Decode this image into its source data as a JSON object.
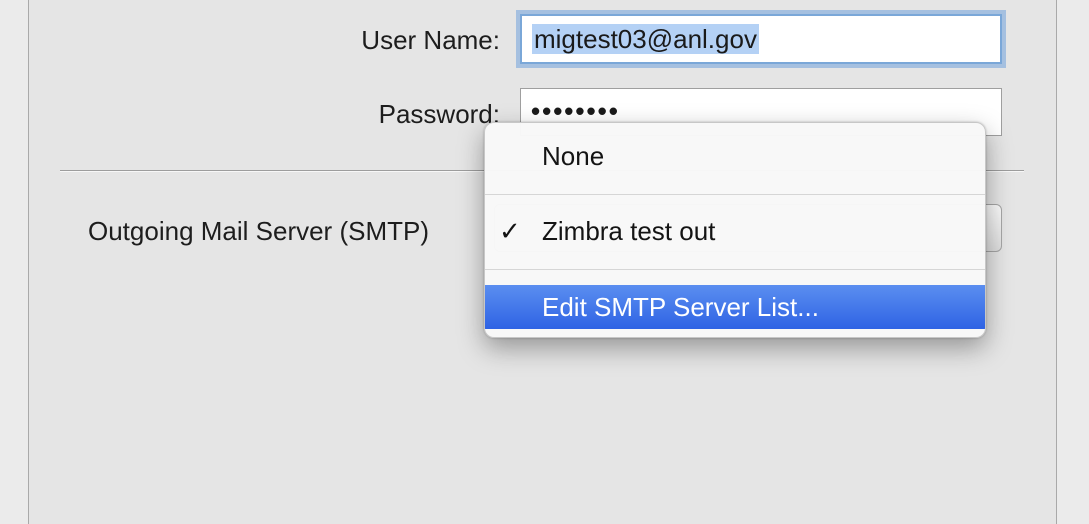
{
  "account_form": {
    "user_name_label": "User Name:",
    "user_name_value": "migtest03@anl.gov",
    "password_label": "Password:",
    "password_mask": "••••••••",
    "smtp_label": "Outgoing Mail Server (SMTP)"
  },
  "smtp_menu": {
    "items": [
      {
        "label": "None",
        "checked": false,
        "highlighted": false
      },
      {
        "label": "Zimbra test out",
        "checked": true,
        "highlighted": false
      },
      {
        "label": "Edit SMTP Server List...",
        "checked": false,
        "highlighted": true
      }
    ],
    "check_glyph": "✓"
  },
  "colors": {
    "menu_highlight": "#3b6fe8",
    "focus_ring": "#71a3dd",
    "text_selection": "#b4d1f5"
  }
}
